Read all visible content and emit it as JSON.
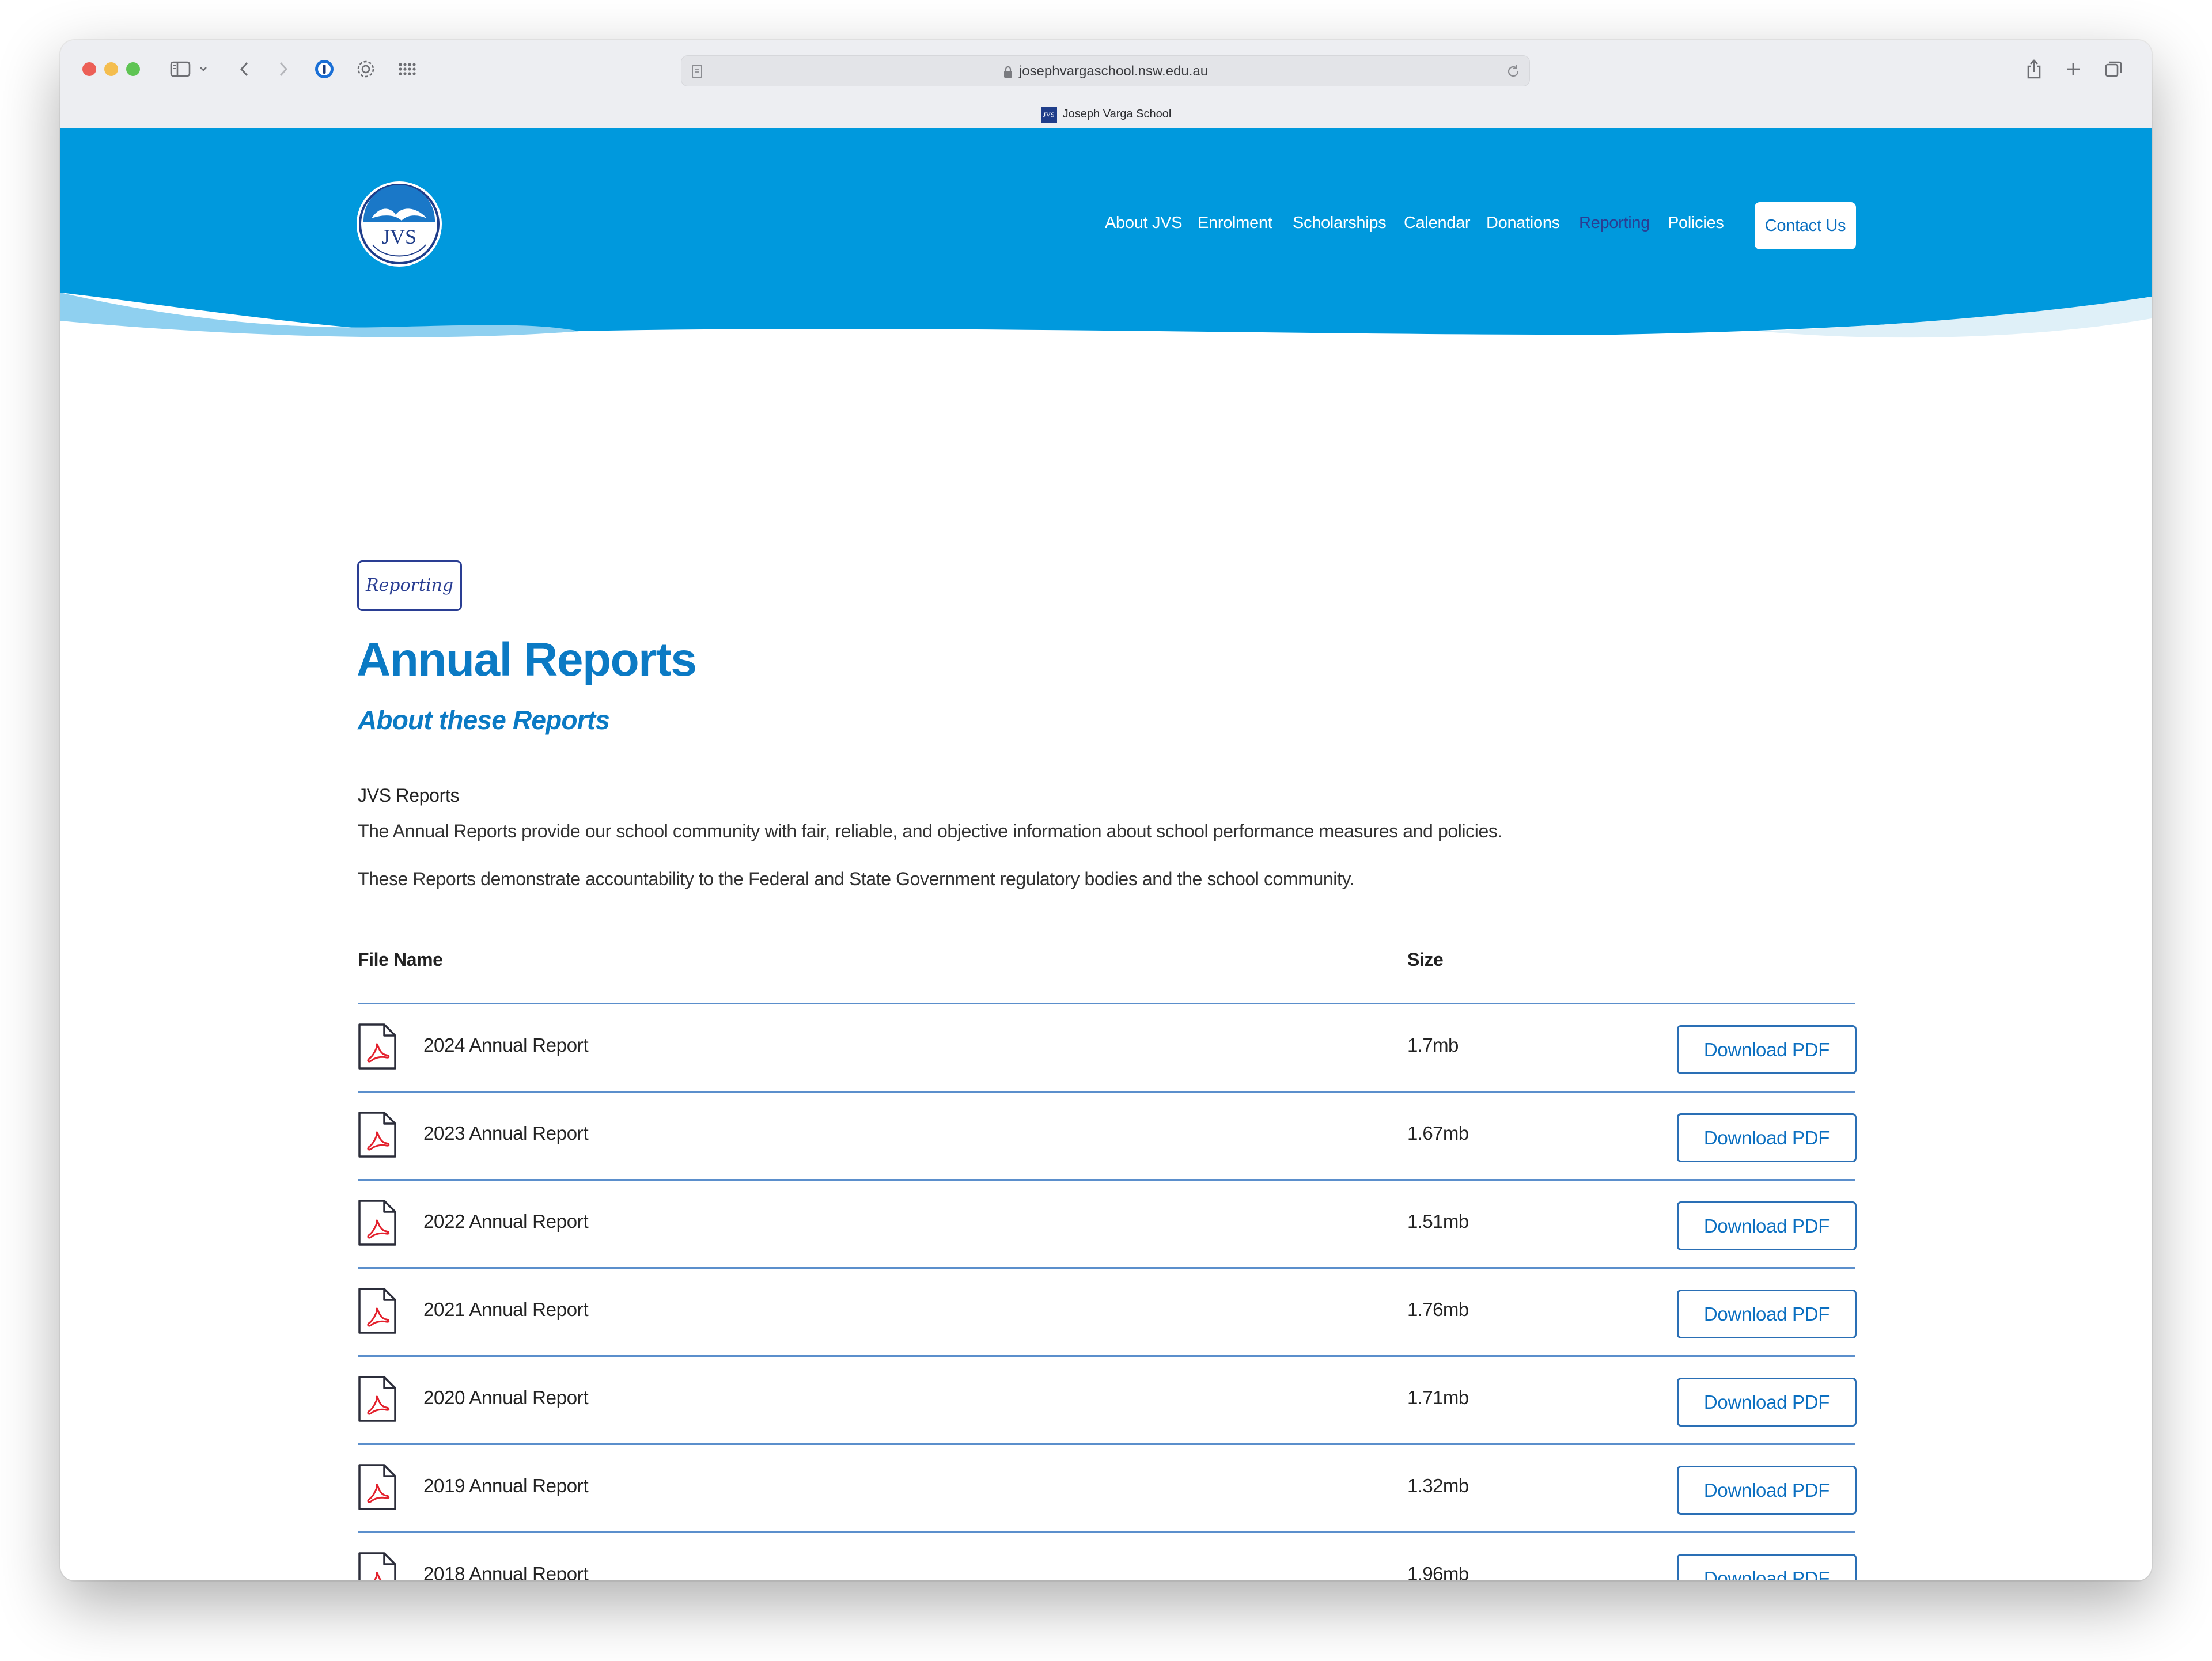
{
  "browser": {
    "url": "josephvargaschool.nsw.edu.au",
    "tab_title": "Joseph Varga School",
    "tab_favicon_text": "JVS"
  },
  "site": {
    "logo_text": "JVS",
    "nav": [
      "About JVS",
      "Enrolment",
      "Scholarships",
      "Calendar",
      "Donations",
      "Reporting",
      "Policies"
    ],
    "active_nav": "Reporting",
    "contact_label": "Contact Us"
  },
  "content": {
    "tag": "Reporting",
    "title": "Annual Reports",
    "subtitle": "About these Reports",
    "section_heading": "JVS Reports",
    "paragraphs": [
      "The Annual Reports provide our school community with fair, reliable, and objective information about school performance measures and policies.",
      "These Reports demonstrate accountability to the Federal and State Government regulatory bodies and the school community."
    ],
    "table": {
      "headers": [
        "File Name",
        "Size"
      ],
      "button_label": "Download PDF",
      "rows": [
        {
          "name": "2024 Annual Report",
          "size": "1.7mb"
        },
        {
          "name": "2023 Annual Report",
          "size": "1.67mb"
        },
        {
          "name": "2022 Annual Report",
          "size": "1.51mb"
        },
        {
          "name": "2021 Annual Report",
          "size": "1.76mb"
        },
        {
          "name": "2020 Annual Report",
          "size": "1.71mb"
        },
        {
          "name": "2019 Annual Report",
          "size": "1.32mb"
        },
        {
          "name": "2018 Annual Report",
          "size": "1.96mb"
        }
      ]
    }
  },
  "colors": {
    "header_blue": "#0099dd",
    "accent_blue": "#0b7ac4",
    "navy": "#2a3e93",
    "pdf_red": "#e3202c"
  }
}
